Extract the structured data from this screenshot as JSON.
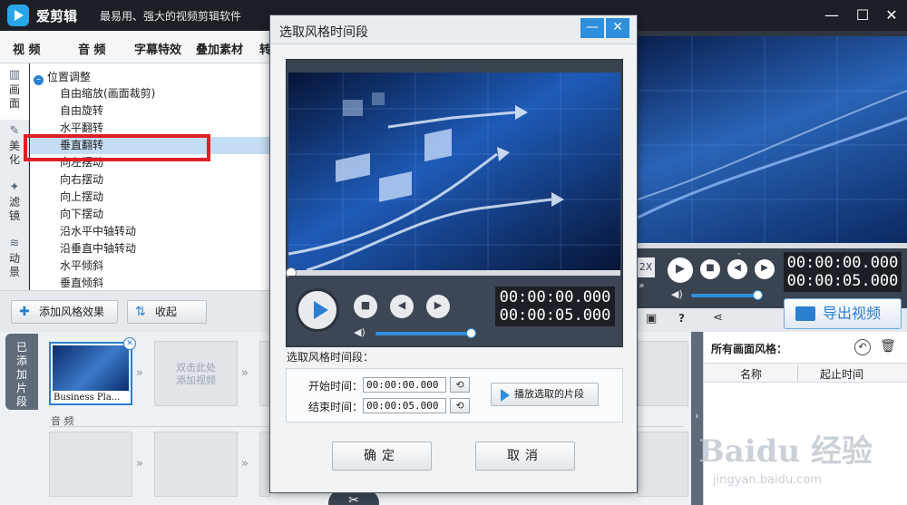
{
  "app": {
    "name": "爱剪辑",
    "slogan": "最易用、强大的视频剪辑软件",
    "minimize_icon": "minimize-icon",
    "maximize_icon": "maximize-icon",
    "close_icon": "close-icon"
  },
  "menu": {
    "tabs": [
      "视 频",
      "音 频",
      "字幕特效",
      "叠加素材",
      "转"
    ]
  },
  "vtabs": [
    {
      "label": "画面",
      "icon": "screen-icon",
      "active": true
    },
    {
      "label": "美化",
      "icon": "brush-icon",
      "active": false
    },
    {
      "label": "滤镜",
      "icon": "wand-icon",
      "active": false
    },
    {
      "label": "动景",
      "icon": "wave-icon",
      "active": false
    }
  ],
  "effects": {
    "group": "位置调整",
    "items": [
      "自由缩放(画面裁剪)",
      "自由旋转",
      "水平翻转",
      "垂直翻转",
      "向左摆动",
      "向右摆动",
      "向上摆动",
      "向下摆动",
      "沿水平中轴转动",
      "沿垂直中轴转动",
      "水平倾斜",
      "垂直倾斜"
    ],
    "selected_index": 3
  },
  "effects_bar": {
    "add_label": "添加风格效果",
    "collapse_label": "收起"
  },
  "timeline": {
    "tab_label": "已添加片段",
    "clip_name": "Business Pla...",
    "slot_hint": "双击此处\n添加视频",
    "audio_label": "音 频"
  },
  "right_player": {
    "time_current": "00:00:00.000",
    "time_total": "00:00:05.000",
    "speed_label": "2X",
    "export_label": "导出视频"
  },
  "style_panel": {
    "title": "所有画面风格：",
    "col_name": "名称",
    "col_time": "起止时间"
  },
  "watermark": {
    "brand": "Baidu 经验",
    "url": "jingyan.baidu.com"
  },
  "dialog": {
    "title": "选取风格时间段",
    "time_current": "00:00:00.000",
    "time_total": "00:00:05.000",
    "section_label": "选取风格时间段：",
    "start_label": "开始时间：",
    "start_value": "00:00:00.000",
    "end_label": "结束时间：",
    "end_value": "00:00:05.000",
    "play_selected_label": "播放选取的片段",
    "ok_label": "确定",
    "cancel_label": "取消",
    "volume_level": 0.95,
    "seek_position": 0.0
  },
  "colors": {
    "accent": "#2b7fd0",
    "highlight_box": "#e01f26",
    "selected_row": "#c4ddf3"
  }
}
